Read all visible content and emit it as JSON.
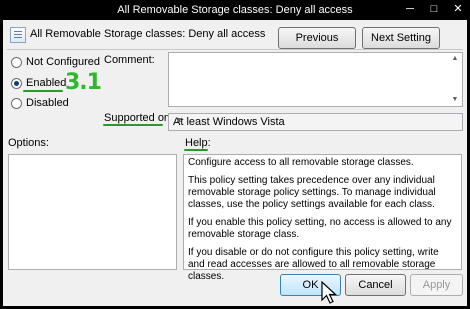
{
  "window": {
    "title": "All Removable Storage classes: Deny all access",
    "min_glyph": "─",
    "max_glyph": "□",
    "close_glyph": "✕"
  },
  "header": {
    "title": "All Removable Storage classes: Deny all access",
    "previous_label": "Previous Setting",
    "next_label": "Next Setting"
  },
  "state": {
    "options": [
      {
        "label": "Not Configured",
        "checked": false
      },
      {
        "label": "Enabled",
        "checked": true
      },
      {
        "label": "Disabled",
        "checked": false
      }
    ]
  },
  "comment": {
    "label": "Comment:",
    "value": ""
  },
  "supported": {
    "label": "Supported on:",
    "value": "At least Windows Vista"
  },
  "options_panel": {
    "label": "Options:"
  },
  "help_panel": {
    "label": "Help:",
    "paragraphs": [
      "Configure access to all removable storage classes.",
      "This policy setting takes precedence over any individual removable storage policy settings. To manage individual classes, use the policy settings available for each class.",
      "If you enable this policy setting, no access is allowed to any removable storage class.",
      "If you disable or do not configure this policy setting, write and read accesses are allowed to all removable storage classes."
    ]
  },
  "footer": {
    "ok_label": "OK",
    "cancel_label": "Cancel",
    "apply_label": "Apply"
  },
  "annotation": {
    "step_text": "3.1",
    "color": "#2fb82f"
  }
}
